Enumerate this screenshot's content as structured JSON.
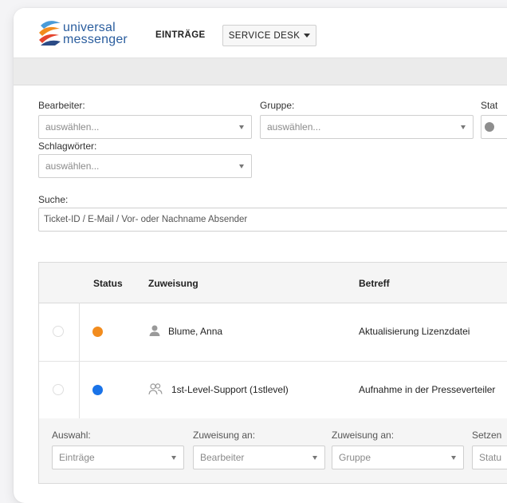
{
  "header": {
    "logo_line1": "universal",
    "logo_line2": "messenger",
    "nav_entries": "EINTRÄGE",
    "nav_service_desk": "SERVICE DESK"
  },
  "filters": {
    "bearbeiter_label": "Bearbeiter:",
    "bearbeiter_placeholder": "auswählen...",
    "gruppe_label": "Gruppe:",
    "gruppe_placeholder": "auswählen...",
    "status_label": "Stat",
    "schlagwoerter_label": "Schlagwörter:",
    "schlagwoerter_placeholder": "auswählen...",
    "suche_label": "Suche:",
    "suche_placeholder": "Ticket-ID / E-Mail / Vor- oder Nachname Absender"
  },
  "table": {
    "columns": {
      "status": "Status",
      "zuweisung": "Zuweisung",
      "betreff": "Betreff"
    },
    "rows": [
      {
        "status_color": "#f28c1e",
        "assignee_icon": "user-icon",
        "assignee": "Blume, Anna",
        "subject": "Aktualisierung Lizenzdatei"
      },
      {
        "status_color": "#1a73e8",
        "assignee_icon": "group-icon",
        "assignee": "1st-Level-Support (1stlevel)",
        "subject": "Aufnahme in der Presseverteiler"
      }
    ]
  },
  "footer": {
    "auswahl_label": "Auswahl:",
    "auswahl_value": "Einträge",
    "zuweisung1_label": "Zuweisung an:",
    "zuweisung1_value": "Bearbeiter",
    "zuweisung2_label": "Zuweisung an:",
    "zuweisung2_value": "Gruppe",
    "setzen_label": "Setzen",
    "setzen_value": "Statu"
  }
}
